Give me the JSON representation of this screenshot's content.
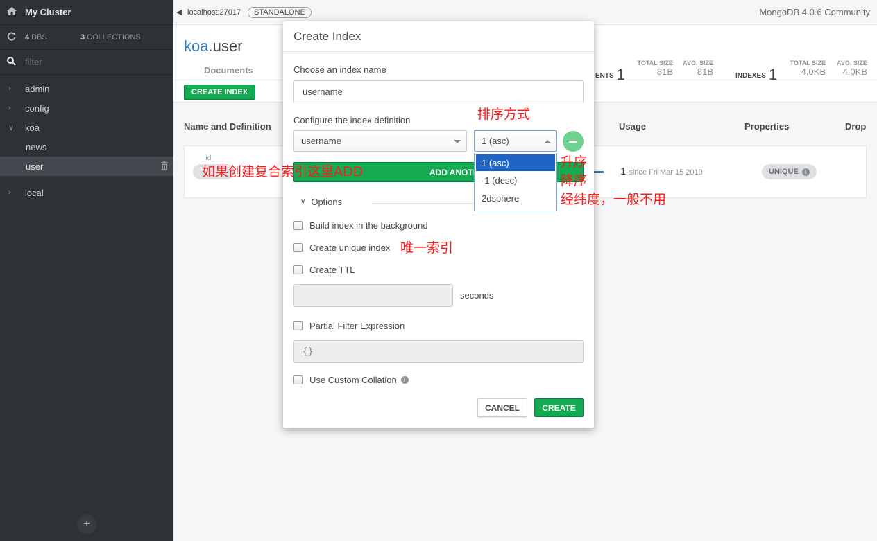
{
  "sidebar": {
    "cluster_name": "My Cluster",
    "db_count": "4",
    "db_label": "DBS",
    "coll_count": "3",
    "coll_label": "COLLECTIONS",
    "filter_placeholder": "filter",
    "databases": [
      "admin",
      "config",
      "koa",
      "local"
    ],
    "koa_collections": [
      "news",
      "user"
    ],
    "add_label": "+"
  },
  "topbar": {
    "host": "localhost:27017",
    "topology": "STANDALONE",
    "version": "MongoDB 4.0.6 Community"
  },
  "namespace": {
    "db": "koa",
    "collection": ".user",
    "tab_documents": "Documents",
    "documents_label": "ENTS",
    "documents_count": "1",
    "doc_total_size_label": "TOTAL SIZE",
    "doc_total_size": "81B",
    "doc_avg_size_label": "AVG. SIZE",
    "doc_avg_size": "81B",
    "indexes_label": "INDEXES",
    "indexes_count": "1",
    "idx_total_size_label": "TOTAL SIZE",
    "idx_total_size": "4.0KB",
    "idx_avg_size_label": "AVG. SIZE",
    "idx_avg_size": "4.0KB"
  },
  "toolbar": {
    "create_index": "CREATE INDEX"
  },
  "index_table": {
    "headers": {
      "name": "Name and Definition",
      "usage": "Usage",
      "properties": "Properties",
      "drop": "Drop"
    },
    "row": {
      "name": "_id_",
      "usage_count": "1",
      "usage_since": "since Fri Mar 15 2019",
      "property": "UNIQUE"
    }
  },
  "modal": {
    "title": "Create Index",
    "name_label": "Choose an index name",
    "name_value": "username",
    "definition_label": "Configure the index definition",
    "field_value": "username",
    "order_value": "1 (asc)",
    "order_options": [
      "1 (asc)",
      "-1 (desc)",
      "2dsphere"
    ],
    "add_field": "ADD ANOTHER FIELD",
    "options_label": "Options",
    "opt_background": "Build index in the background",
    "opt_unique": "Create unique index",
    "opt_ttl": "Create TTL",
    "ttl_seconds": "seconds",
    "opt_partial": "Partial Filter Expression",
    "partial_placeholder": "{}",
    "opt_collation": "Use Custom Collation",
    "cancel": "CANCEL",
    "create": "CREATE"
  },
  "annotations": {
    "sort_method": "排序方式",
    "compound_hint": "如果创建复合索引这里ADD",
    "asc": "升序",
    "desc": "降序",
    "geo": "经纬度，一般不用",
    "unique": "唯一索引"
  },
  "colors": {
    "sidebar_bg": "#2d3237",
    "accent_green": "#13aa52",
    "selected_option": "#1e65c5",
    "annotation_red": "#ff1a1a"
  }
}
